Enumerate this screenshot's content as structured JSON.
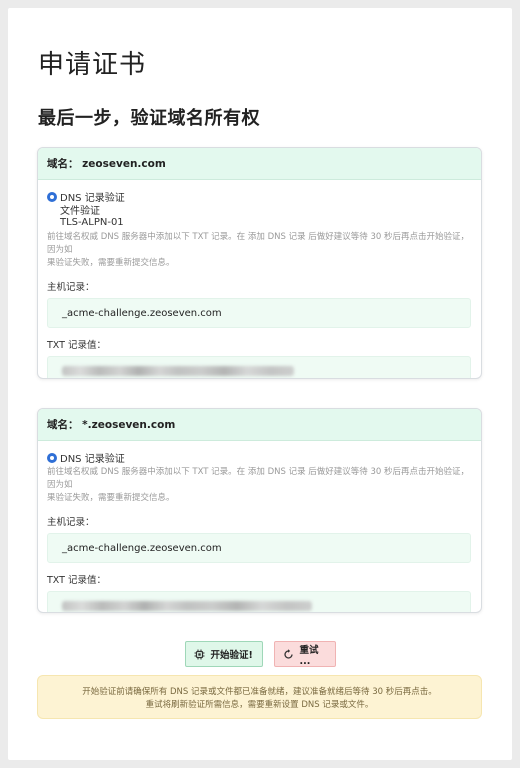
{
  "page": {
    "title": "申请证书",
    "subtitle": "最后一步，验证域名所有权"
  },
  "cards": [
    {
      "header": "域名： zeoseven.com",
      "options": [
        "DNS 记录验证",
        "文件验证",
        "TLS-ALPN-01"
      ],
      "selected_option": "DNS 记录验证",
      "hint_line1": "前往域名权威 DNS 服务器中添加以下 TXT 记录。在 添加 DNS 记录 后做好建议等待 30 秒后再点击开始验证，因为如",
      "hint_line2": "果验证失败，需要重新提交信息。",
      "host_label": "主机记录：",
      "host_value": "_acme-challenge.zeoseven.com",
      "txt_label": "TXT 记录值："
    },
    {
      "header": "域名： *.zeoseven.com",
      "options": [
        "DNS 记录验证"
      ],
      "selected_option": "DNS 记录验证",
      "hint_line1": "前往域名权威 DNS 服务器中添加以下 TXT 记录。在 添加 DNS 记录 后做好建议等待 30 秒后再点击开始验证，因为如",
      "hint_line2": "果验证失败，需要重新提交信息。",
      "host_label": "主机记录：",
      "host_value": "_acme-challenge.zeoseven.com",
      "txt_label": "TXT 记录值："
    }
  ],
  "buttons": {
    "start_label": "开始验证!",
    "start_icon": "chip-icon",
    "retry_label": "重试 ...",
    "retry_icon": "refresh-icon"
  },
  "notice": {
    "line1": "开始验证前请确保所有 DNS 记录或文件都已准备就绪，建议准备就绪后等待 30 秒后再点击。",
    "line2": "重试将刷新验证所需信息，需要重新设置 DNS 记录或文件。"
  },
  "colors": {
    "accent": "#2f6fd6",
    "card_header_bg": "#e3f9ee",
    "field_bg": "#effbf4",
    "start_btn_bg": "#dff7e9",
    "retry_btn_bg": "#fbdcdc",
    "notice_bg": "#fdf3d3"
  }
}
